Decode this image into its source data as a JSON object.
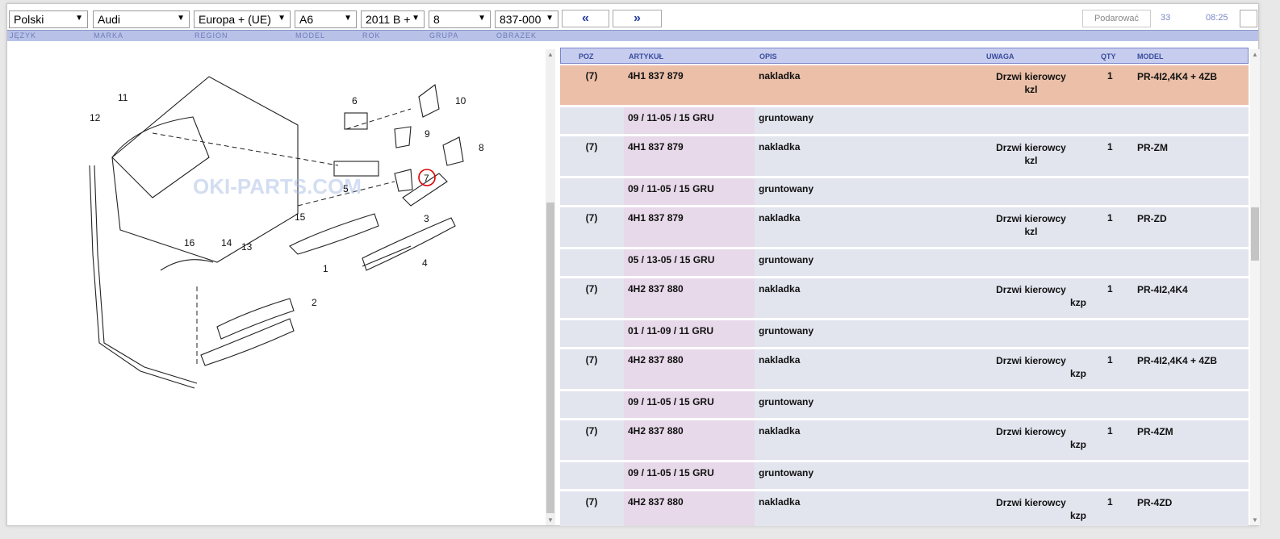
{
  "toolbar": {
    "language": "Polski",
    "brand": "Audi",
    "region": "Europa + (UE)",
    "model": "A6",
    "year": "2011 B +",
    "group": "8",
    "image": "837-000",
    "prev_label": "«",
    "next_label": "»",
    "gift_label": "Podarować",
    "count": "33",
    "time": "08:25"
  },
  "labels": {
    "language": "JĘZYK",
    "brand": "MARKA",
    "region": "REGION",
    "model": "MODEL",
    "year": "ROK",
    "group": "GRUPA",
    "image": "OBRAZEK"
  },
  "diagram": {
    "callouts": [
      "1",
      "2",
      "3",
      "4",
      "5",
      "6",
      "7",
      "8",
      "9",
      "10",
      "11",
      "12",
      "13",
      "14",
      "15",
      "16"
    ],
    "highlighted": "7",
    "watermark": "OKI-PARTS.COM"
  },
  "table": {
    "headers": {
      "poz": "POZ",
      "artykul": "ARTYKUŁ",
      "opis": "OPIS",
      "uwaga": "UWAGA",
      "qty": "QTY",
      "model": "MODEL"
    },
    "rows": [
      {
        "type": "main",
        "poz": "(7)",
        "artykul": "4H1 837 879",
        "opis": "nakladka",
        "uwaga1": "Drzwi kierowcy",
        "uwaga2": "kzl",
        "qty": "1",
        "model": "PR-4I2,4K4 + 4ZB",
        "highlight": true
      },
      {
        "type": "sub",
        "artykul": "09 / 11-05 / 15 GRU",
        "opis": "gruntowany"
      },
      {
        "type": "main",
        "poz": "(7)",
        "artykul": "4H1 837 879",
        "opis": "nakladka",
        "uwaga1": "Drzwi kierowcy",
        "uwaga2": "kzl",
        "qty": "1",
        "model": "PR-ZM"
      },
      {
        "type": "sub",
        "artykul": "09 / 11-05 / 15 GRU",
        "opis": "gruntowany"
      },
      {
        "type": "main",
        "poz": "(7)",
        "artykul": "4H1 837 879",
        "opis": "nakladka",
        "uwaga1": "Drzwi kierowcy",
        "uwaga2": "kzl",
        "qty": "1",
        "model": "PR-ZD"
      },
      {
        "type": "sub",
        "artykul": "05 / 13-05 / 15 GRU",
        "opis": "gruntowany"
      },
      {
        "type": "main",
        "poz": "(7)",
        "artykul": "4H2 837 880",
        "opis": "nakladka",
        "uwaga1": "Drzwi kierowcy",
        "kzp": "kzp",
        "qty": "1",
        "model": "PR-4I2,4K4"
      },
      {
        "type": "sub",
        "artykul": "01 / 11-09 / 11 GRU",
        "opis": "gruntowany"
      },
      {
        "type": "main",
        "poz": "(7)",
        "artykul": "4H2 837 880",
        "opis": "nakladka",
        "uwaga1": "Drzwi kierowcy",
        "kzp": "kzp",
        "qty": "1",
        "model": "PR-4I2,4K4 + 4ZB"
      },
      {
        "type": "sub",
        "artykul": "09 / 11-05 / 15 GRU",
        "opis": "gruntowany"
      },
      {
        "type": "main",
        "poz": "(7)",
        "artykul": "4H2 837 880",
        "opis": "nakladka",
        "uwaga1": "Drzwi kierowcy",
        "kzp": "kzp",
        "qty": "1",
        "model": "PR-4ZM"
      },
      {
        "type": "sub",
        "artykul": "09 / 11-05 / 15 GRU",
        "opis": "gruntowany"
      },
      {
        "type": "main",
        "poz": "(7)",
        "artykul": "4H2 837 880",
        "opis": "nakladka",
        "uwaga1": "Drzwi kierowcy",
        "kzp": "kzp",
        "qty": "1",
        "model": "PR-4ZD"
      }
    ]
  }
}
